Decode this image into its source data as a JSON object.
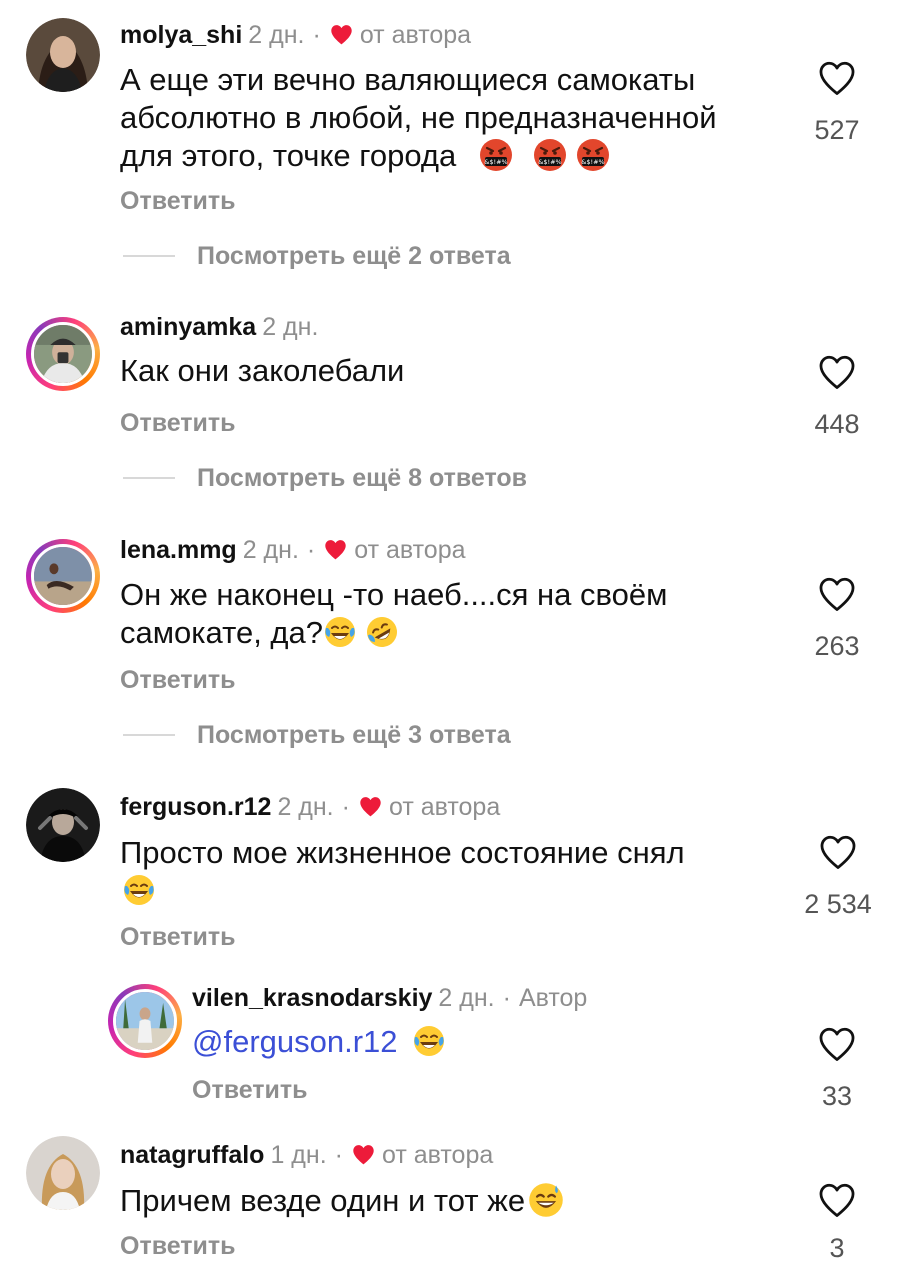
{
  "ui": {
    "reply_label": "Ответить",
    "dot": "·",
    "author_like": "от автора",
    "colors": {
      "heart": "#ed1b3a",
      "mention": "#3b4fd6",
      "meta": "#8e8e8e"
    }
  },
  "comments": [
    {
      "username": "molya_shi",
      "time": "2 дн.",
      "liked_by_author": true,
      "line1": "А еще эти вечно валяющиеся самокаты",
      "line2": "абсолютно в любой, не предназначенной",
      "line3": "для этого, точке города",
      "emojis": [
        "angry-face-emoji",
        "angry-face-emoji",
        "angry-face-emoji"
      ],
      "likes": "527",
      "view_more": "Посмотреть ещё 2 ответа"
    },
    {
      "username": "aminyamka",
      "time": "2 дн.",
      "liked_by_author": false,
      "line1": "Как они заколебали",
      "likes": "448",
      "view_more": "Посмотреть ещё 8 ответов"
    },
    {
      "username": "lena.mmg",
      "time": "2 дн.",
      "liked_by_author": true,
      "line1": "Он же наконец -то наеб....ся на своём",
      "line2": "самокате, да?",
      "emojis": [
        "tears-of-joy-emoji",
        "rolling-laughing-emoji"
      ],
      "likes": "263",
      "view_more": "Посмотреть ещё 3 ответа"
    },
    {
      "username": "ferguson.r12",
      "time": "2 дн.",
      "liked_by_author": true,
      "line1": "Просто мое жизненное состояние  снял",
      "emojis": [
        "tears-of-joy-emoji"
      ],
      "likes": "2 534"
    },
    {
      "username": "vilen_krasnodarskiy",
      "time": "2 дн.",
      "author_label": "Автор",
      "mention": "@ferguson.r12",
      "emojis": [
        "tears-of-joy-emoji"
      ],
      "likes": "33"
    },
    {
      "username": "natagruffalo",
      "time": "1 дн.",
      "liked_by_author": true,
      "line1": "Причем везде один и тот же",
      "emojis": [
        "sweat-smile-emoji"
      ],
      "likes": "3"
    }
  ]
}
